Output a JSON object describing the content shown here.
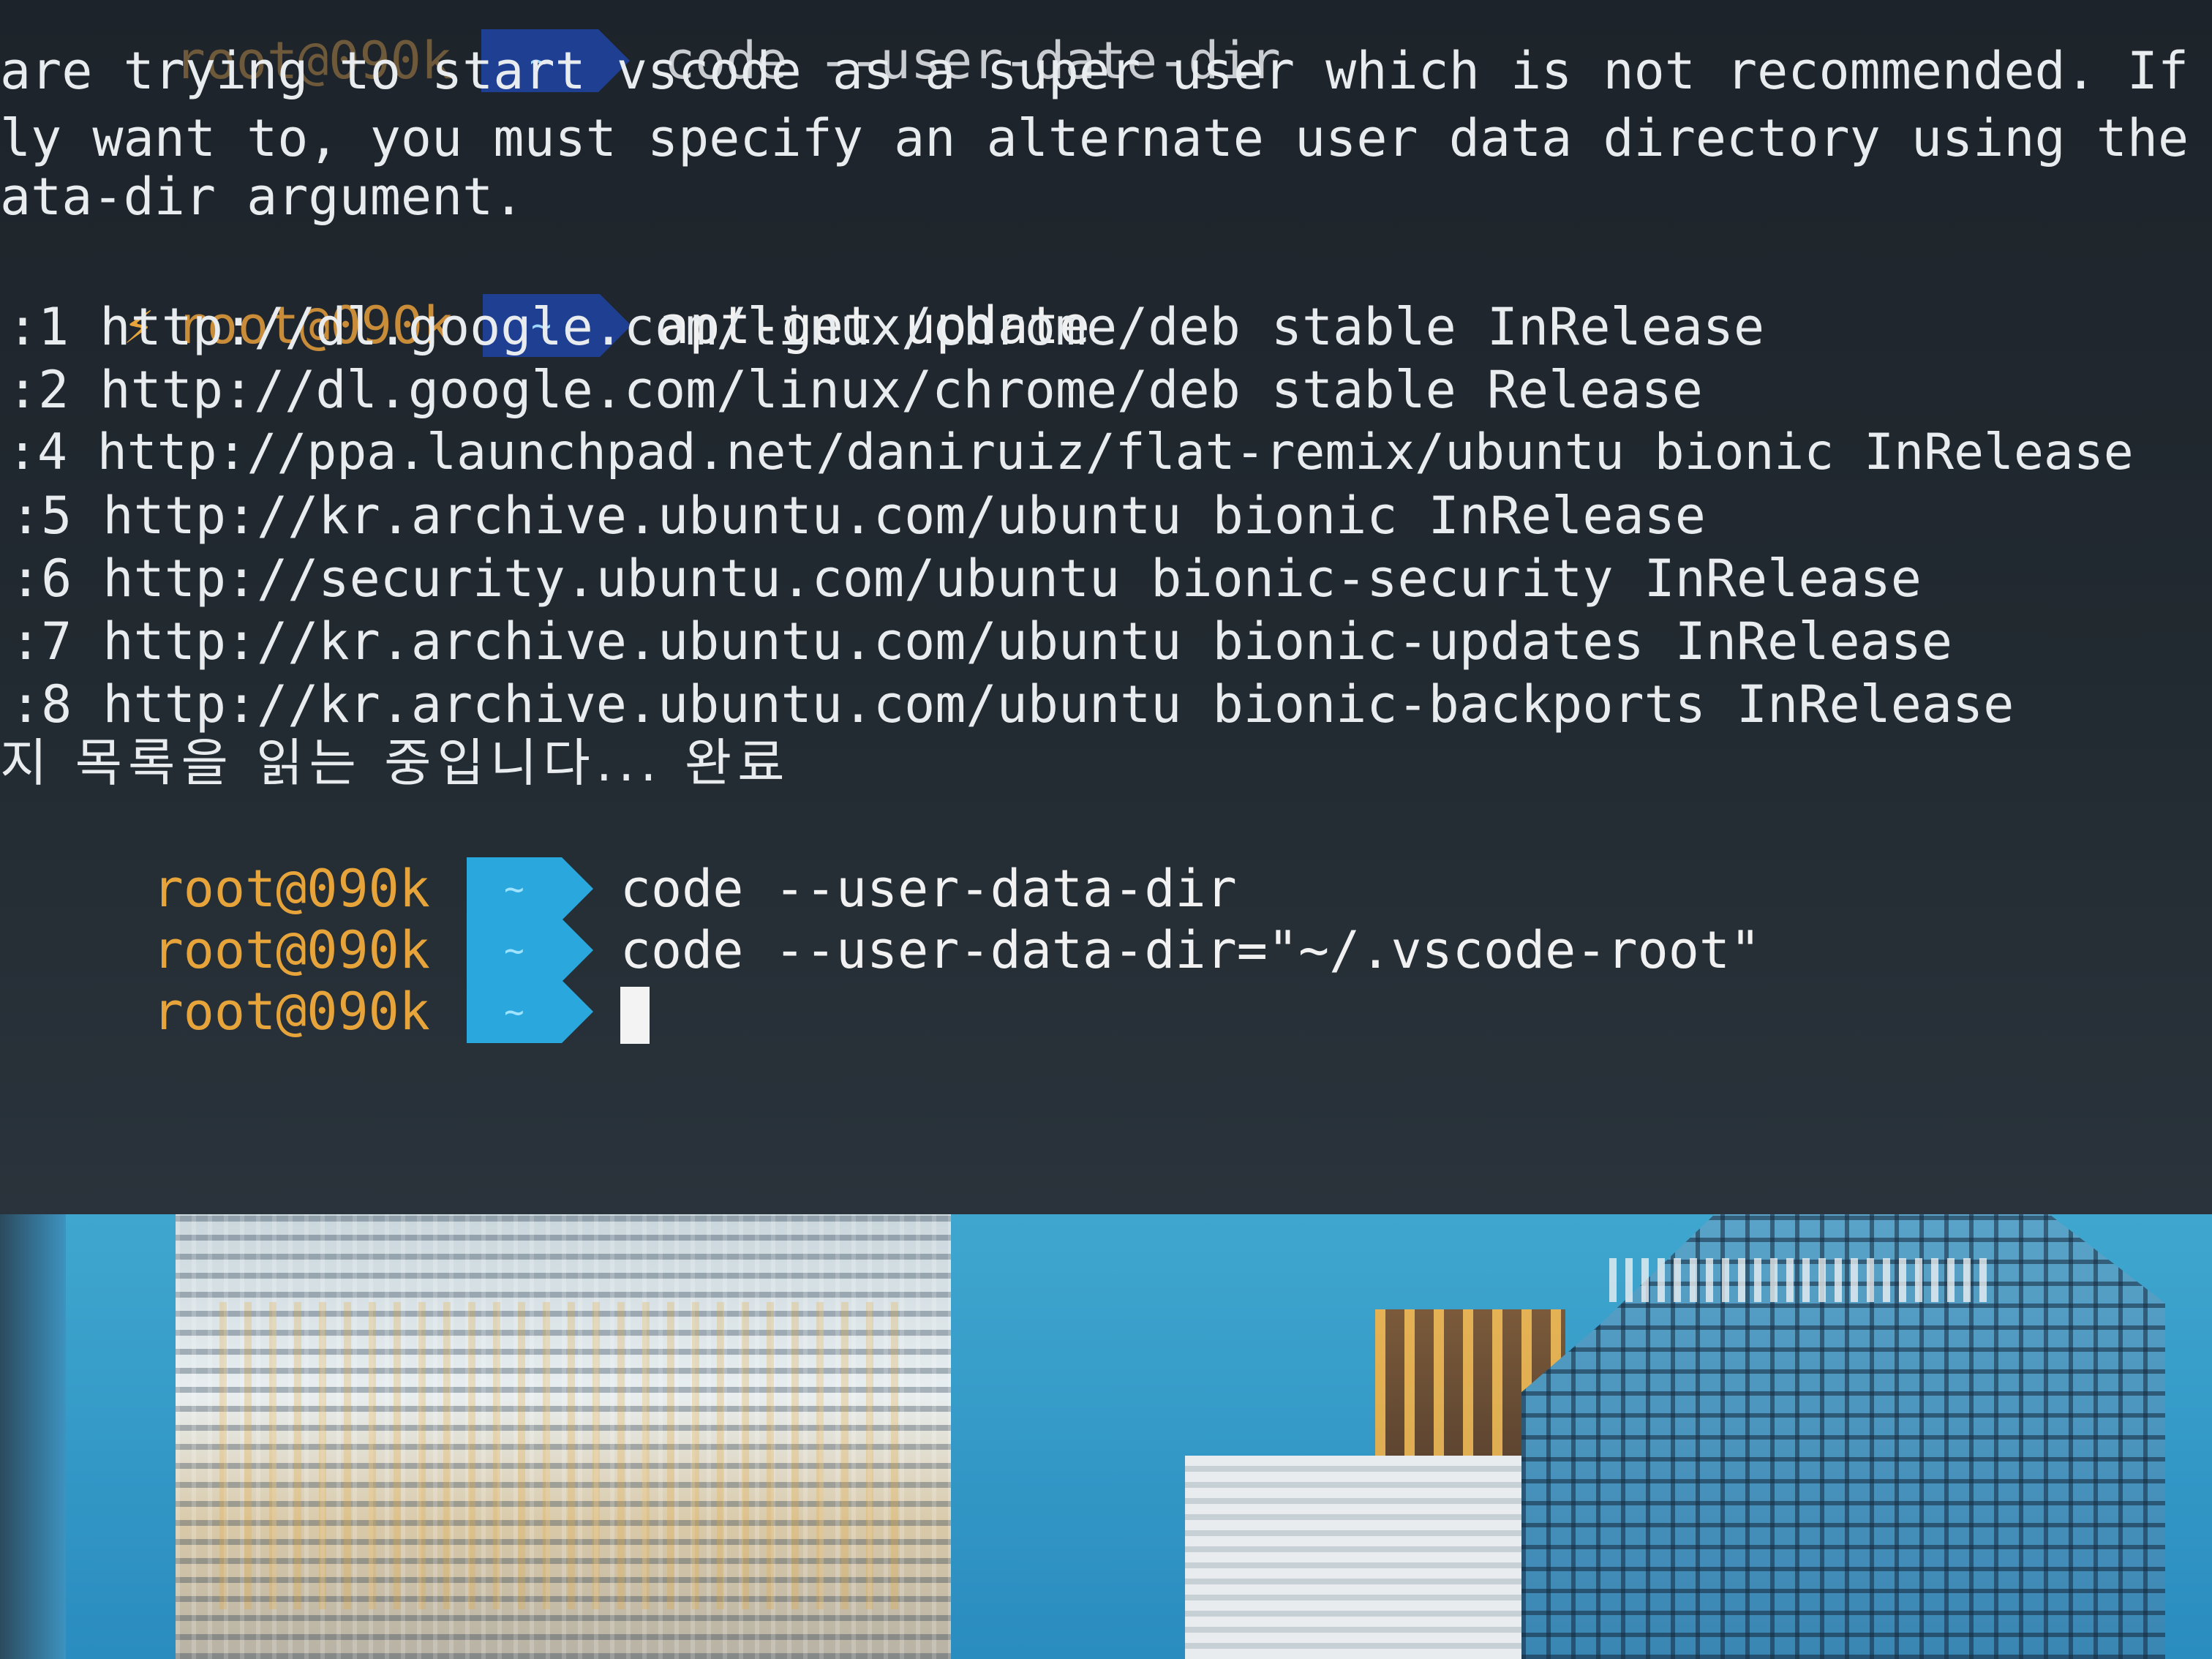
{
  "terminal": {
    "top_prompt": {
      "user": "root@090k",
      "dir": "~",
      "command": "code --user-date-dir"
    },
    "warning_lines": [
      "are trying to start vscode as a super user which is not recommended. If",
      "ly want to, you must specify an alternate user data directory using the",
      "ata-dir argument."
    ],
    "prompt_apt": {
      "bolt": "⚡",
      "user": "root@090k",
      "dir": "~",
      "command": "apt-get update"
    },
    "apt_lines": [
      ":1 http://dl.google.com/linux/chrome/deb stable InRelease",
      ":2 http://dl.google.com/linux/chrome/deb stable Release",
      ":4 http://ppa.launchpad.net/daniruiz/flat-remix/ubuntu bionic InRelease",
      ":5 http://kr.archive.ubuntu.com/ubuntu bionic InRelease",
      ":6 http://security.ubuntu.com/ubuntu bionic-security InRelease",
      ":7 http://kr.archive.ubuntu.com/ubuntu bionic-updates InRelease",
      ":8 http://kr.archive.ubuntu.com/ubuntu bionic-backports InRelease"
    ],
    "status_line": "지 목록을 읽는 중입니다... 완료",
    "prompts": [
      {
        "user": "root@090k",
        "dir": "~",
        "command": "code --user-data-dir"
      },
      {
        "user": "root@090k",
        "dir": "~",
        "command": "code --user-data-dir=\"~/.vscode-root\""
      },
      {
        "user": "root@090k",
        "dir": "~",
        "command": ""
      }
    ]
  },
  "colors": {
    "prompt_user": "#e7a43a",
    "segment_dark": "#1f3f93",
    "segment_light": "#2aa7dd",
    "text": "#e9ecef"
  },
  "wallpaper": {
    "subject": "city skyscrapers"
  }
}
